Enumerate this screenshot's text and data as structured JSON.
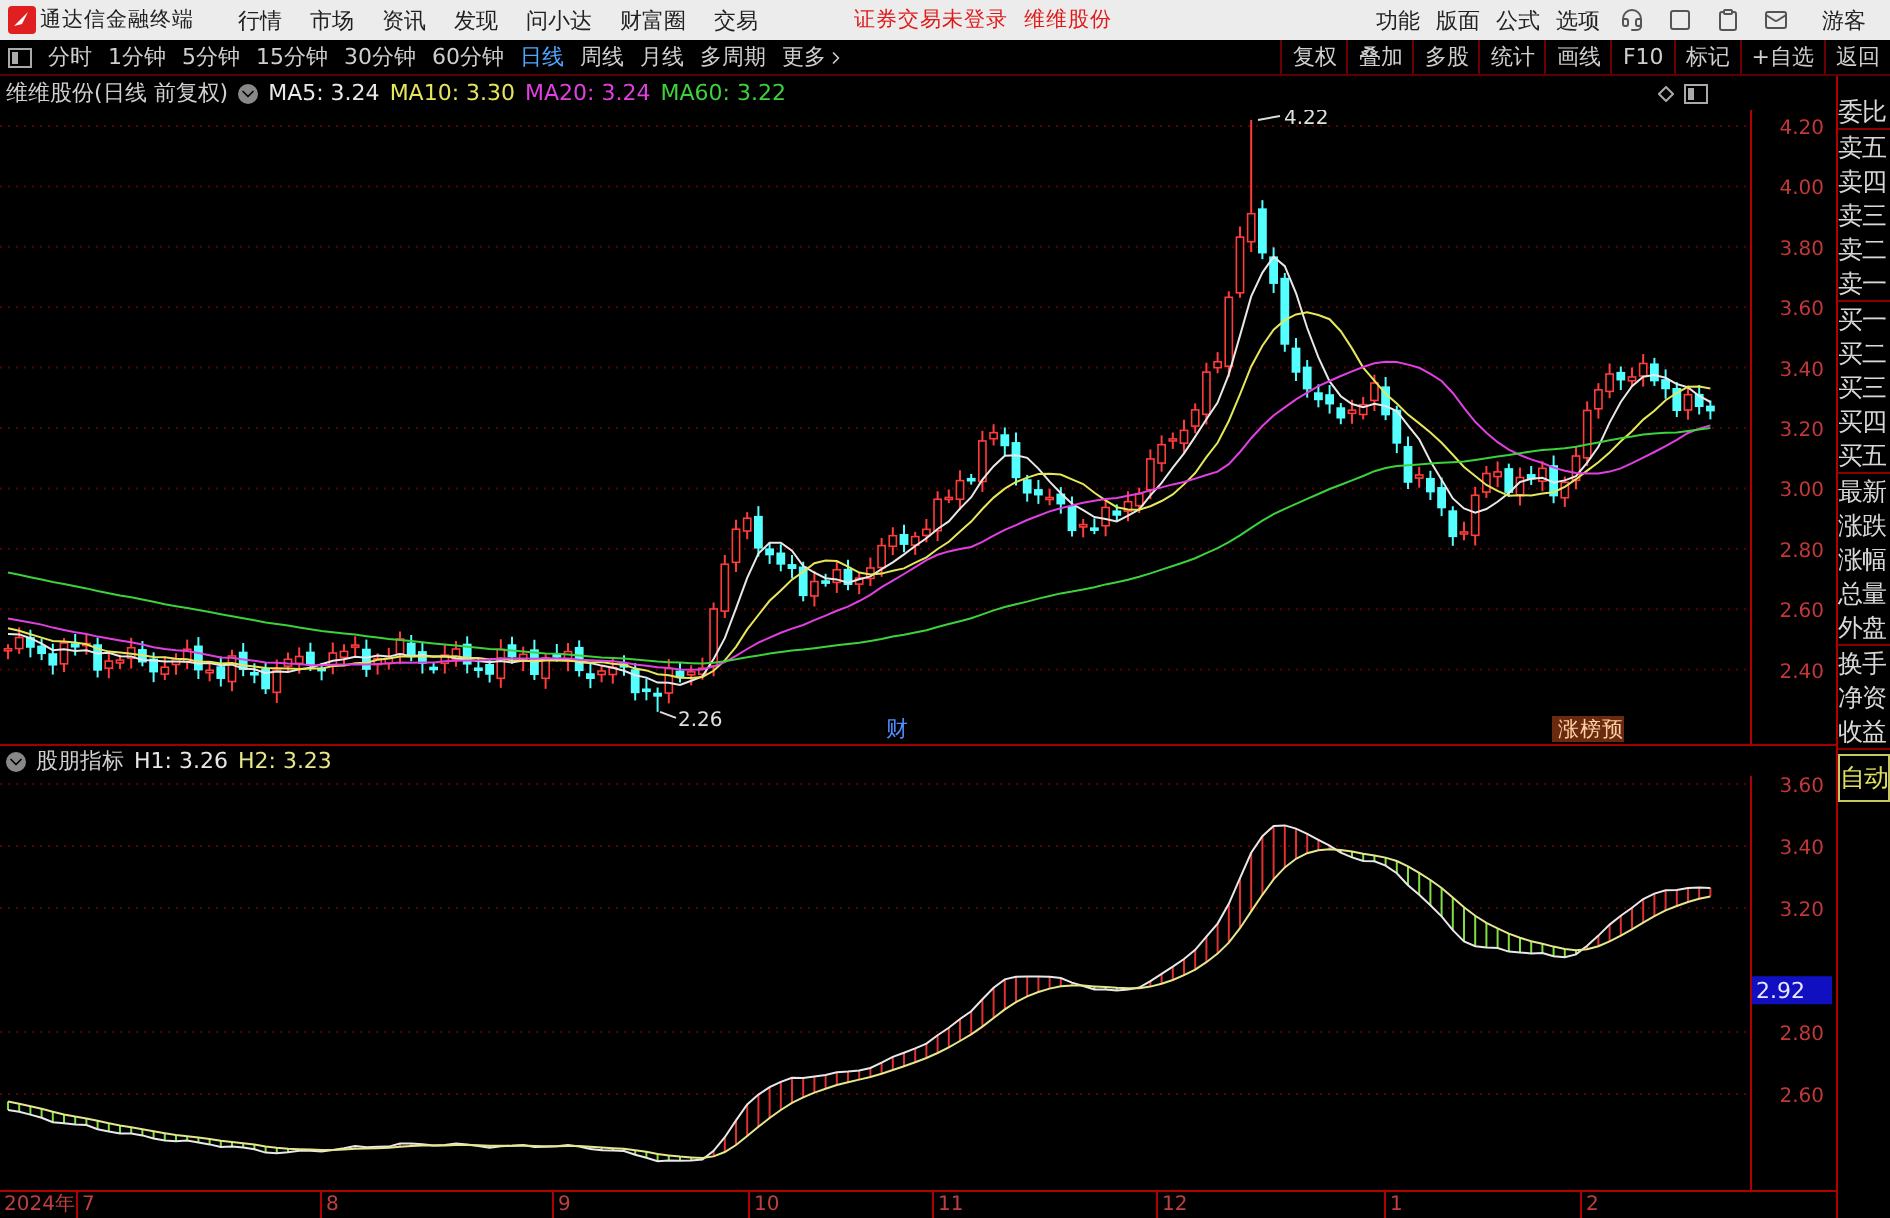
{
  "title_bar": {
    "app_name": "通达信金融终端",
    "menu": [
      "行情",
      "市场",
      "资讯",
      "发现",
      "问小达",
      "财富圈",
      "交易"
    ],
    "notices": [
      "证券交易未登录",
      "维维股份"
    ],
    "tools": [
      "功能",
      "版面",
      "公式",
      "选项"
    ],
    "user": "游客"
  },
  "period_tabs": [
    {
      "label": "分时",
      "selected": false
    },
    {
      "label": "1分钟",
      "selected": false
    },
    {
      "label": "5分钟",
      "selected": false
    },
    {
      "label": "15分钟",
      "selected": false
    },
    {
      "label": "30分钟",
      "selected": false
    },
    {
      "label": "60分钟",
      "selected": false
    },
    {
      "label": "日线",
      "selected": true
    },
    {
      "label": "周线",
      "selected": false
    },
    {
      "label": "月线",
      "selected": false
    },
    {
      "label": "多周期",
      "selected": false
    },
    {
      "label": "更多",
      "selected": false
    }
  ],
  "chart_tools": [
    "复权",
    "叠加",
    "多股",
    "统计",
    "画线",
    "F10",
    "标记",
    "+自选",
    "返回"
  ],
  "price_panel": {
    "title": "维维股份(日线 前复权)",
    "ma": [
      {
        "label": "MA5: 3.24",
        "color": "#e8e8e8"
      },
      {
        "label": "MA10: 3.30",
        "color": "#e6e65a"
      },
      {
        "label": "MA20: 3.24",
        "color": "#e040e0"
      },
      {
        "label": "MA60: 3.22",
        "color": "#3cd23c"
      }
    ],
    "y_ticks": [
      "4.20",
      "4.00",
      "3.80",
      "3.60",
      "3.40",
      "3.20",
      "3.00",
      "2.80",
      "2.60",
      "2.40"
    ],
    "annotations": [
      {
        "kind": "high",
        "text": "4.22"
      },
      {
        "kind": "low",
        "text": "2.26"
      },
      {
        "kind": "event",
        "text": "财"
      },
      {
        "kind": "tag",
        "text": "涨榜预"
      }
    ]
  },
  "indicator_panel": {
    "title": "股朋指标",
    "values": [
      {
        "label": "H1: 3.26",
        "color": "#e8e8e8"
      },
      {
        "label": "H2: 3.23",
        "color": "#e6e68c"
      }
    ],
    "y_ticks": [
      "3.60",
      "3.40",
      "3.20",
      "2.80",
      "2.60"
    ],
    "current_value": "2.92"
  },
  "x_axis": {
    "year": "2024年",
    "months": [
      "7",
      "8",
      "9",
      "10",
      "11",
      "12",
      "1",
      "2"
    ]
  },
  "quote_sidebar": {
    "groups": [
      [
        "委比"
      ],
      [
        "卖五",
        "卖四",
        "卖三",
        "卖二",
        "卖一"
      ],
      [
        "买一",
        "买二",
        "买三",
        "买四",
        "买五"
      ],
      [
        "最新",
        "涨跌",
        "涨幅",
        "总量",
        "外盘"
      ],
      [
        "换手",
        "净资",
        "收益"
      ]
    ],
    "mode": "自动"
  }
}
